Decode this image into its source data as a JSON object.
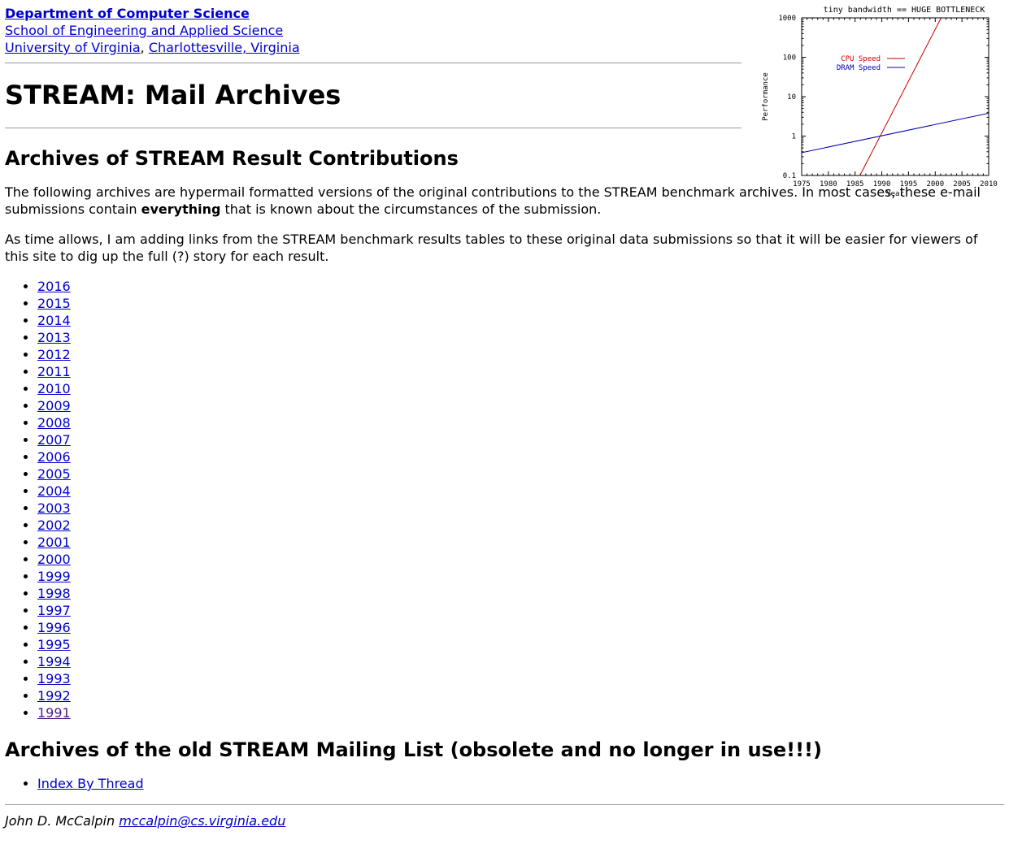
{
  "header": {
    "dept_link": "Department of Computer Science",
    "school_link": "School of Engineering and Applied Science",
    "univ_link": "University of Virginia",
    "comma": ", ",
    "city_link": "Charlottesville, Virginia"
  },
  "page_title": "STREAM: Mail Archives",
  "section1": {
    "heading": "Archives of STREAM Result Contributions",
    "para1_part1": "The following archives are hypermail formatted versions of the original contributions to the STREAM benchmark archives. In most cases, these e-mail submissions contain ",
    "para1_bold": "everything",
    "para1_part2": " that is known about the circumstances of the submission.",
    "para2": "As time allows, I am adding links from the STREAM benchmark results tables to these original data submissions so that it will be easier for viewers of this site to dig up the full (?) story for each result."
  },
  "years": [
    "2016",
    "2015",
    "2014",
    "2013",
    "2012",
    "2011",
    "2010",
    "2009",
    "2008",
    "2007",
    "2006",
    "2005",
    "2004",
    "2003",
    "2002",
    "2001",
    "2000",
    "1999",
    "1998",
    "1997",
    "1996",
    "1995",
    "1994",
    "1993",
    "1992",
    "1991"
  ],
  "section2": {
    "heading": "Archives of the old STREAM Mailing List (obsolete and no longer in use!!!)",
    "thread_link": "Index By Thread"
  },
  "footer": {
    "author": "John D. McCalpin",
    "email": "mccalpin@cs.virginia.edu"
  },
  "colors": {
    "link": "#0000cc",
    "visited": "#551a8b",
    "cpu_line": "#cc0000",
    "dram_line": "#0000aa"
  },
  "chart_data": {
    "type": "line",
    "title": "tiny bandwidth == HUGE BOTTLENECK",
    "xlabel": "Year",
    "ylabel": "Performance",
    "xlim": [
      1975,
      2010
    ],
    "ylim": [
      0.1,
      1000
    ],
    "yscale": "log",
    "x_ticks": [
      "1975",
      "1980",
      "1985",
      "1990",
      "1995",
      "2000",
      "2005",
      "2010"
    ],
    "y_ticks": [
      "0.1",
      "1",
      "10",
      "100",
      "1000"
    ],
    "legend_position": "top-left",
    "series": [
      {
        "name": "CPU Speed",
        "color": "#cc0000",
        "x": [
          1985.9,
          2001.1
        ],
        "y": [
          0.1,
          1000
        ]
      },
      {
        "name": "DRAM Speed",
        "color": "#0000aa",
        "x": [
          1975,
          2010
        ],
        "y": [
          0.38,
          3.8
        ]
      }
    ]
  }
}
